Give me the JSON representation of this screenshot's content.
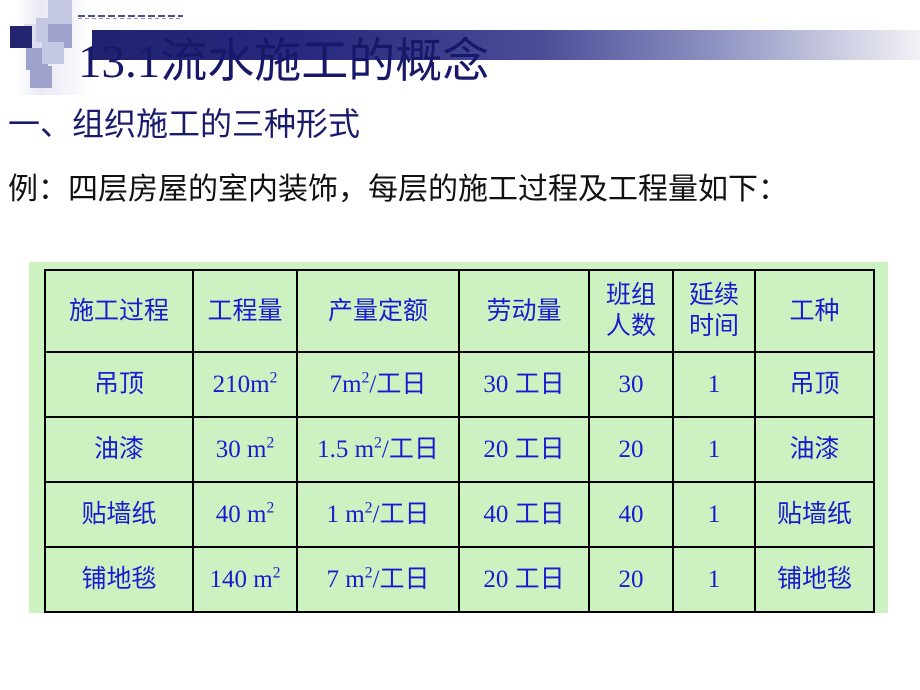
{
  "slide": {
    "title": "13.1流水施工的概念",
    "subtitle": "一、组织施工的三种形式",
    "example": "例：四层房屋的室内装饰，每层的施工过程及工程量如下：",
    "accent_color": "#18186b",
    "table_fill_color": "#ccf2c2",
    "table_text_color": "#1a1ad0"
  },
  "table": {
    "headers": [
      {
        "line1": "施工过程",
        "line2": ""
      },
      {
        "line1": "工程量",
        "line2": ""
      },
      {
        "line1": "产量定额",
        "line2": ""
      },
      {
        "line1": "劳动量",
        "line2": ""
      },
      {
        "line1": "班组",
        "line2": "人数"
      },
      {
        "line1": "延续",
        "line2": "时间"
      },
      {
        "line1": "工种",
        "line2": ""
      }
    ],
    "rows": [
      {
        "process": "吊顶",
        "quantity_num": "210m",
        "quantity_sup": "2",
        "output_num": "7m",
        "output_sup": "2",
        "output_unit": "/工日",
        "labor": "30 工日",
        "crew": "30",
        "duration": "1",
        "trade": "吊顶"
      },
      {
        "process": "油漆",
        "quantity_num": "30 m",
        "quantity_sup": "2",
        "output_num": "1.5 m",
        "output_sup": "2",
        "output_unit": "/工日",
        "labor": "20 工日",
        "crew": "20",
        "duration": "1",
        "trade": "油漆"
      },
      {
        "process": "贴墙纸",
        "quantity_num": "40 m",
        "quantity_sup": "2",
        "output_num": "1 m",
        "output_sup": "2",
        "output_unit": "/工日",
        "labor": "40 工日",
        "crew": "40",
        "duration": "1",
        "trade": "贴墙纸"
      },
      {
        "process": "铺地毯",
        "quantity_num": "140 m",
        "quantity_sup": "2",
        "output_num": "7 m",
        "output_sup": "2",
        "output_unit": "/工日",
        "labor": "20 工日",
        "crew": "20",
        "duration": "1",
        "trade": "铺地毯"
      }
    ]
  }
}
